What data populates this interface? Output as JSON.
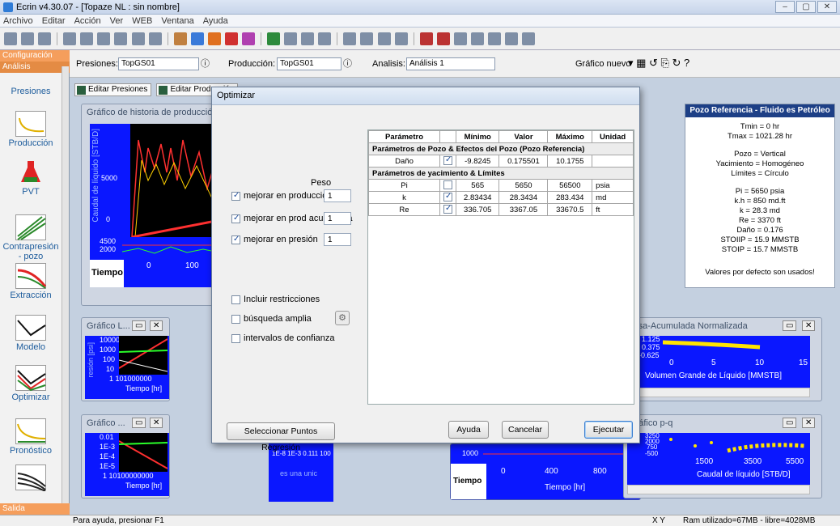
{
  "window": {
    "title": "Ecrin  v4.30.07 - [Topaze NL : sin nombre]",
    "controls": [
      "–",
      "▢",
      "✕"
    ]
  },
  "menu": [
    "Archivo",
    "Editar",
    "Acción",
    "Ver",
    "WEB",
    "Ventana",
    "Ayuda"
  ],
  "sidebar": {
    "header1": "Configuración",
    "header2": "Análisis",
    "items": [
      "Presiones",
      "Producción",
      "PVT",
      "Contrapresión - pozo",
      "Extracción",
      "Modelo",
      "Optimizar",
      "Pronóstico"
    ],
    "footer": "Salida"
  },
  "subtoolbar": {
    "presiones_label": "Presiones:",
    "presiones_value": "TopGS01",
    "produccion_label": "Producción:",
    "produccion_value": "TopGS01",
    "analisis_label": "Analisis:",
    "analisis_value": "Análisis 1",
    "grafico_nuevo": "Gráfico nuevo"
  },
  "tabs": [
    "Editar Presiones",
    "Editar Producción"
  ],
  "history_panel": {
    "title": "Gráfico de historia de producción",
    "ylabel": "Caudal de líquido [STB/D]",
    "ytick": "5000",
    "ytick0": "0",
    "lower_ticks": [
      "4500",
      "2000"
    ],
    "xlabel": "Tiempo",
    "xticks": [
      "0",
      "100"
    ]
  },
  "dialog": {
    "title": "Optimizar",
    "weight_header": "Peso",
    "options": [
      {
        "label": "mejorar en producción",
        "checked": true,
        "weight": "1"
      },
      {
        "label": "mejorar en prod acumulada",
        "checked": true,
        "weight": "1"
      },
      {
        "label": "mejorar en presión",
        "checked": true,
        "weight": "1"
      }
    ],
    "extra_options": [
      {
        "label": "Incluir restricciones",
        "checked": false
      },
      {
        "label": "búsqueda amplia",
        "checked": false
      },
      {
        "label": "intervalos de confianza",
        "checked": false
      }
    ],
    "table": {
      "headers": [
        "Parámetro",
        "Mínimo",
        "Valor",
        "Máximo",
        "Unidad"
      ],
      "section1": "Parámetros de Pozo & Efectos del Pozo (Pozo Referencia)",
      "rows1": [
        {
          "param": "Daño",
          "checked": true,
          "min": "-9.8245",
          "val": "0.175501",
          "max": "10.1755",
          "unit": ""
        }
      ],
      "section2": "Parámetros de yacimiento & Límites",
      "rows2": [
        {
          "param": "Pi",
          "checked": false,
          "min": "565",
          "val": "5650",
          "max": "56500",
          "unit": "psia"
        },
        {
          "param": "k",
          "checked": true,
          "min": "2.83434",
          "val": "28.3434",
          "max": "283.434",
          "unit": "md"
        },
        {
          "param": "Re",
          "checked": true,
          "min": "336.705",
          "val": "3367.05",
          "max": "33670.5",
          "unit": "ft"
        }
      ]
    },
    "btn_regression": "Seleccionar Puntos Regresión",
    "btn_help": "Ayuda",
    "btn_cancel": "Cancelar",
    "btn_run": "Ejecutar"
  },
  "infobox": {
    "title": "Pozo Referencia   -   Fluido es Petróleo",
    "lines": [
      "Tmin = 0 hr",
      "Tmax = 1021.28 hr",
      "",
      "Pozo = Vertical",
      "Yacimiento = Homogéneo",
      "Límites = Círculo",
      "",
      "Pi = 5650 psia",
      "k.h = 850 md.ft",
      "k = 28.3 md",
      "Re = 3370 ft",
      "Daño = 0.176",
      "STOIIP = 15.9 MMSTB",
      "STOIP = 15.7 MMSTB",
      "",
      "Valores por defecto son usados!"
    ]
  },
  "small_panels": {
    "loglog1_title": "Gráfico L...",
    "loglog1_ticks": [
      "10000",
      "1000",
      "100",
      "10"
    ],
    "loglog1_xticks": "1 101000000",
    "loglog1_xlabel": "Tiempo [hr]",
    "loglog1_ylabel": "resión [psi]",
    "loglog2_title": "Gráfico ...",
    "loglog2_ticks": [
      "0.01",
      "1E-3",
      "1E-4",
      "1E-5"
    ],
    "loglog2_xticks": "1 10100000000",
    "loglog2_xlabel": "Tiempo [hr]",
    "mid_text": "es una unic",
    "mid_ticks": "1E-8 1E-3 0.111 100",
    "tasa_title": "Tasa-Acumulada Normalizada",
    "tasa_ticks": [
      "1.125",
      "0.375",
      "-0.625"
    ],
    "tasa_xticks": [
      "0",
      "5",
      "10",
      "15"
    ],
    "tasa_xlabel": "Volumen Grande de Líquido [MMSTB]",
    "pq_title": "Gráfico p-q",
    "pq_ticks": [
      "3250",
      "2000",
      "750",
      "-500"
    ],
    "pq_xticks": [
      "1500",
      "3500",
      "5500"
    ],
    "pq_xlabel": "Caudal de líquido [STB/D]",
    "bottom_ytick": "1000",
    "bottom_xticks": [
      "0",
      "400",
      "800"
    ],
    "bottom_xlabel": "Tiempo [hr]",
    "bottom_tiempo": "Tiempo"
  },
  "statusbar": {
    "help": "Para ayuda, presionar F1",
    "xy": "X  Y",
    "ram": "Ram utilizado=67MB - libre=4028MB"
  },
  "colors": {
    "plot_blue": "#0a17ff",
    "accent_orange": "#f59e5c",
    "info_header": "#1d3f86"
  }
}
